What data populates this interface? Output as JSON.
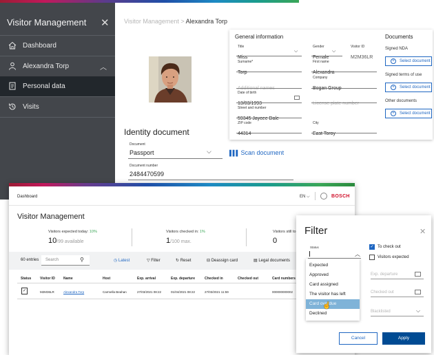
{
  "sidebar": {
    "title": "Visitor Management",
    "close_icon": "close-icon",
    "items": [
      {
        "label": "Dashboard",
        "icon": "home-icon"
      },
      {
        "label": "Alexandra Torp",
        "icon": "person-icon"
      },
      {
        "label": "Personal data",
        "icon": "id-card-icon"
      },
      {
        "label": "Visits",
        "icon": "history-icon"
      }
    ]
  },
  "breadcrumb": {
    "root": "Visitor Management",
    "sep": ">",
    "current": "Alexandra Torp"
  },
  "identity": {
    "title": "Identity document",
    "document_label": "Document",
    "document_value": "Passport",
    "scan_label": "Scan document",
    "number_label": "Document number",
    "number_value": "2484470599"
  },
  "general": {
    "title": "General information",
    "title_label": "Title",
    "title_value": "Miss",
    "gender_label": "Gender",
    "gender_value": "Female",
    "visitor_id_label": "Visitor ID",
    "visitor_id_value": "M2M36LR",
    "surname_label": "Surname*",
    "surname_value": "Torp",
    "first_name_label": "First name",
    "first_name_value": "Alexandra",
    "additional_names_placeholder": "Additional names",
    "company_label": "Company",
    "company_value": "Bogan Group",
    "dob_label": "Date of birth",
    "dob_value": "13/03/1993",
    "license_placeholder": "License plate number",
    "street_label": "Street and number",
    "street_value": "59345 Jaycee Dale",
    "zip_label": "ZIP code",
    "zip_value": "44314",
    "city_label": "City",
    "city_value": "East Toroy"
  },
  "documents": {
    "title": "Documents",
    "items": [
      {
        "label": "Signed NDA",
        "button": "Select document"
      },
      {
        "label": "Signed terms of use",
        "button": "Select document"
      },
      {
        "label": "Other documents",
        "button": "Select document"
      }
    ]
  },
  "dashboard": {
    "nav_label": "Dashboard",
    "lang": "EN",
    "brand": "BOSCH",
    "title": "Visitor Management",
    "stats": [
      {
        "label": "Visitors expected today:",
        "pct": "10%",
        "value": "10",
        "sub": "/99 available"
      },
      {
        "label": "Visitors checked in:",
        "pct": "1%",
        "value": "1",
        "sub": "/100 max."
      },
      {
        "label": "Visitors still to",
        "pct": "",
        "value": "0",
        "sub": ""
      }
    ],
    "entries": "60 entries",
    "search_placeholder": "Search",
    "toolbar": {
      "latest": "Latest",
      "filter": "Filter",
      "reset": "Reset",
      "deassign": "Deassign card",
      "legal": "Legal documents"
    },
    "columns": [
      "Status",
      "Visitor ID",
      "Name",
      "Host",
      "Exp. arrival",
      "Exp. departure",
      "Checked in",
      "Checked out",
      "Card numbers"
    ],
    "row": {
      "visitor_id": "M2M36LR",
      "name": "Alexandra Torp",
      "host": "Carmella Beahan",
      "exp_arrival": "27/03/2021 08:22",
      "exp_departure": "01/04/2021 08:22",
      "checked_in": "27/03/2021 11:59",
      "checked_out": "",
      "card_numbers": "000000000002"
    }
  },
  "filter": {
    "title": "Filter",
    "status_label": "Status",
    "status_options": [
      "Expected",
      "Approved",
      "Card assigned",
      "The visitor has left",
      "Card overdue",
      "Declined"
    ],
    "highlighted_option": "Card overdue",
    "to_check_out": "To check out",
    "visitors_expected": "Visitors expected",
    "exp_departure_placeholder": "Exp. departure",
    "checked_out_placeholder": "Checked out",
    "blacklisted_placeholder": "Blacklisted",
    "cancel": "Cancel",
    "apply": "Apply"
  },
  "colors": {
    "sidebar_bg": "#43464b",
    "sidebar_active": "#22272c",
    "accent_blue": "#1d65c1",
    "apply_blue": "#004b93",
    "brand_red": "#d0102a",
    "highlight": "#7fb3d8"
  }
}
